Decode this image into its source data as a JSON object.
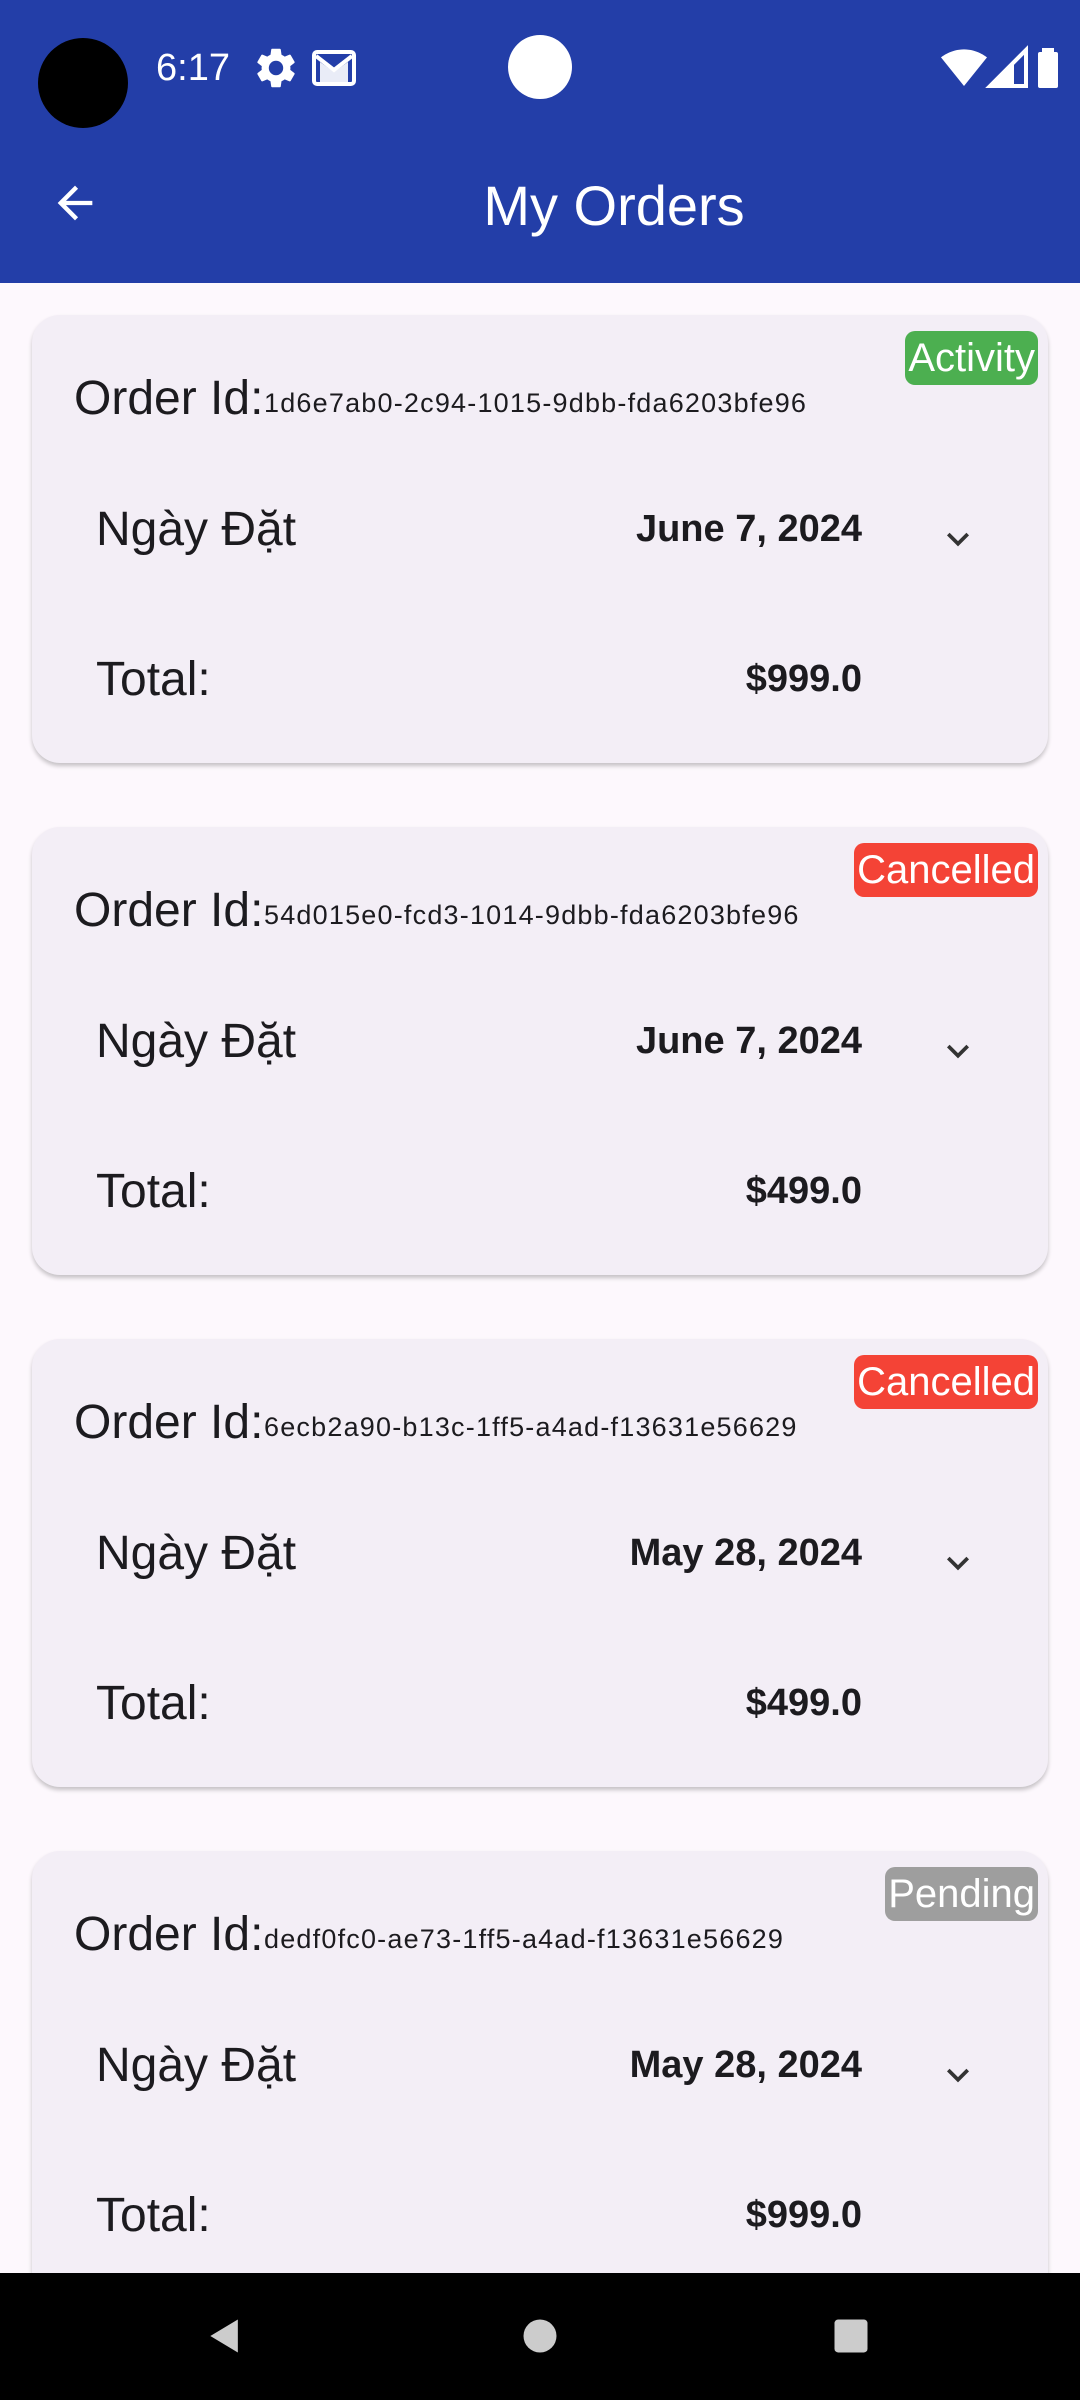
{
  "colors": {
    "primary": "#233ea8",
    "badge_activity": "#4caf50",
    "badge_cancelled": "#f44336",
    "badge_pending": "#9e9e9e"
  },
  "status_bar": {
    "time": "6:17",
    "left_icons": [
      "settings-icon",
      "gmail-icon"
    ],
    "right_icons": [
      "wifi-icon",
      "signal-icon",
      "battery-icon"
    ]
  },
  "app_bar": {
    "title": "My Orders",
    "back_icon": "arrow-back-icon"
  },
  "labels": {
    "order_id": "Order Id:",
    "date": "Ngày Đặt",
    "total": "Total:"
  },
  "orders": [
    {
      "id": "1d6e7ab0-2c94-1015-9dbb-fda6203bfe96",
      "status": "Activity",
      "status_color": "#4caf50",
      "date": "June 7, 2024",
      "total": "$999.0"
    },
    {
      "id": "54d015e0-fcd3-1014-9dbb-fda6203bfe96",
      "status": "Cancelled",
      "status_color": "#f44336",
      "date": "June 7, 2024",
      "total": "$499.0"
    },
    {
      "id": "6ecb2a90-b13c-1ff5-a4ad-f13631e56629",
      "status": "Cancelled",
      "status_color": "#f44336",
      "date": "May 28, 2024",
      "total": "$499.0"
    },
    {
      "id": "dedf0fc0-ae73-1ff5-a4ad-f13631e56629",
      "status": "Pending",
      "status_color": "#9e9e9e",
      "date": "May 28, 2024",
      "total": "$999.0"
    }
  ],
  "nav_bar": {
    "buttons": [
      "back-nav-icon",
      "home-nav-icon",
      "recents-nav-icon"
    ]
  }
}
